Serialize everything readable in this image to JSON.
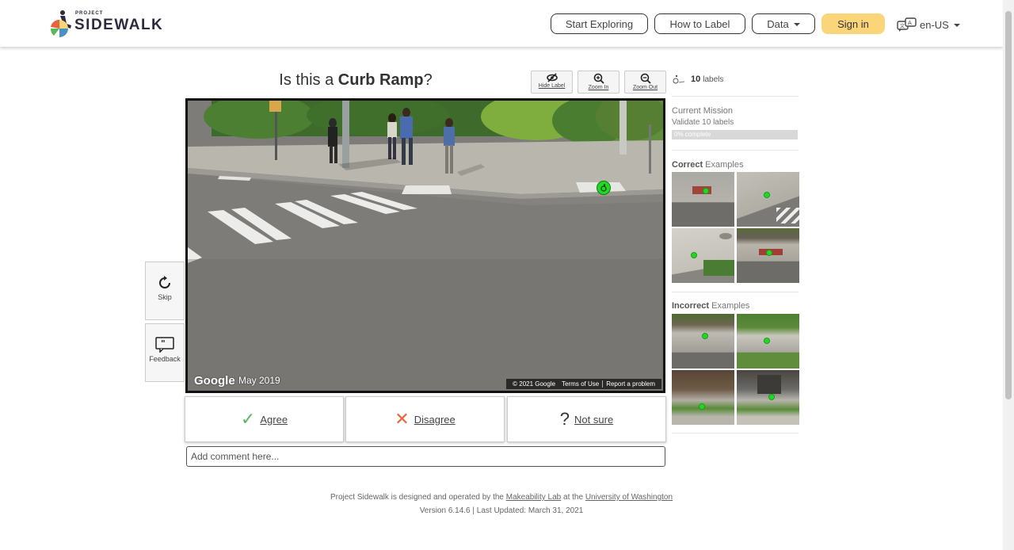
{
  "nav": {
    "logo_small": "PROJECT",
    "logo_big": "SIDEWALK",
    "start_exploring": "Start Exploring",
    "how_to_label": "How to Label",
    "data": "Data",
    "sign_in": "Sign in",
    "language": "en-US"
  },
  "question": {
    "prefix": "Is this a ",
    "label_type": "Curb Ramp",
    "suffix": "?"
  },
  "tools": {
    "hide_label": "Hide Label",
    "zoom_in": "Zoom In",
    "zoom_out": "Zoom Out"
  },
  "pano": {
    "google": "Google",
    "date": "May 2019",
    "copyright": "© 2021 Google",
    "terms": "Terms of Use",
    "report": "Report a problem"
  },
  "side": {
    "skip": "Skip",
    "feedback": "Feedback"
  },
  "vote": {
    "agree": "Agree",
    "disagree": "Disagree",
    "not_sure": "Not sure"
  },
  "comment": {
    "placeholder": "Add comment here..."
  },
  "panel": {
    "label_count": "10",
    "label_word": "labels",
    "mission_title": "Current Mission",
    "mission_sub": "Validate 10 labels",
    "progress_text": "0% complete",
    "progress_fraction": 0,
    "correct_bold": "Correct",
    "incorrect_bold": "Incorrect",
    "examples_word": " Examples"
  },
  "footer": {
    "line1_a": "Project Sidewalk is designed and operated by the ",
    "lab": "Makeability Lab",
    "line1_b": " at the ",
    "uw": "University of Washington",
    "line2": "Version 6.14.6 | Last Updated: March 31, 2021"
  },
  "colors": {
    "sign_in": "#fbd57a",
    "agree_check": "#5cb85c",
    "disagree_x": "#e8643c",
    "label_marker": "#23d723"
  }
}
